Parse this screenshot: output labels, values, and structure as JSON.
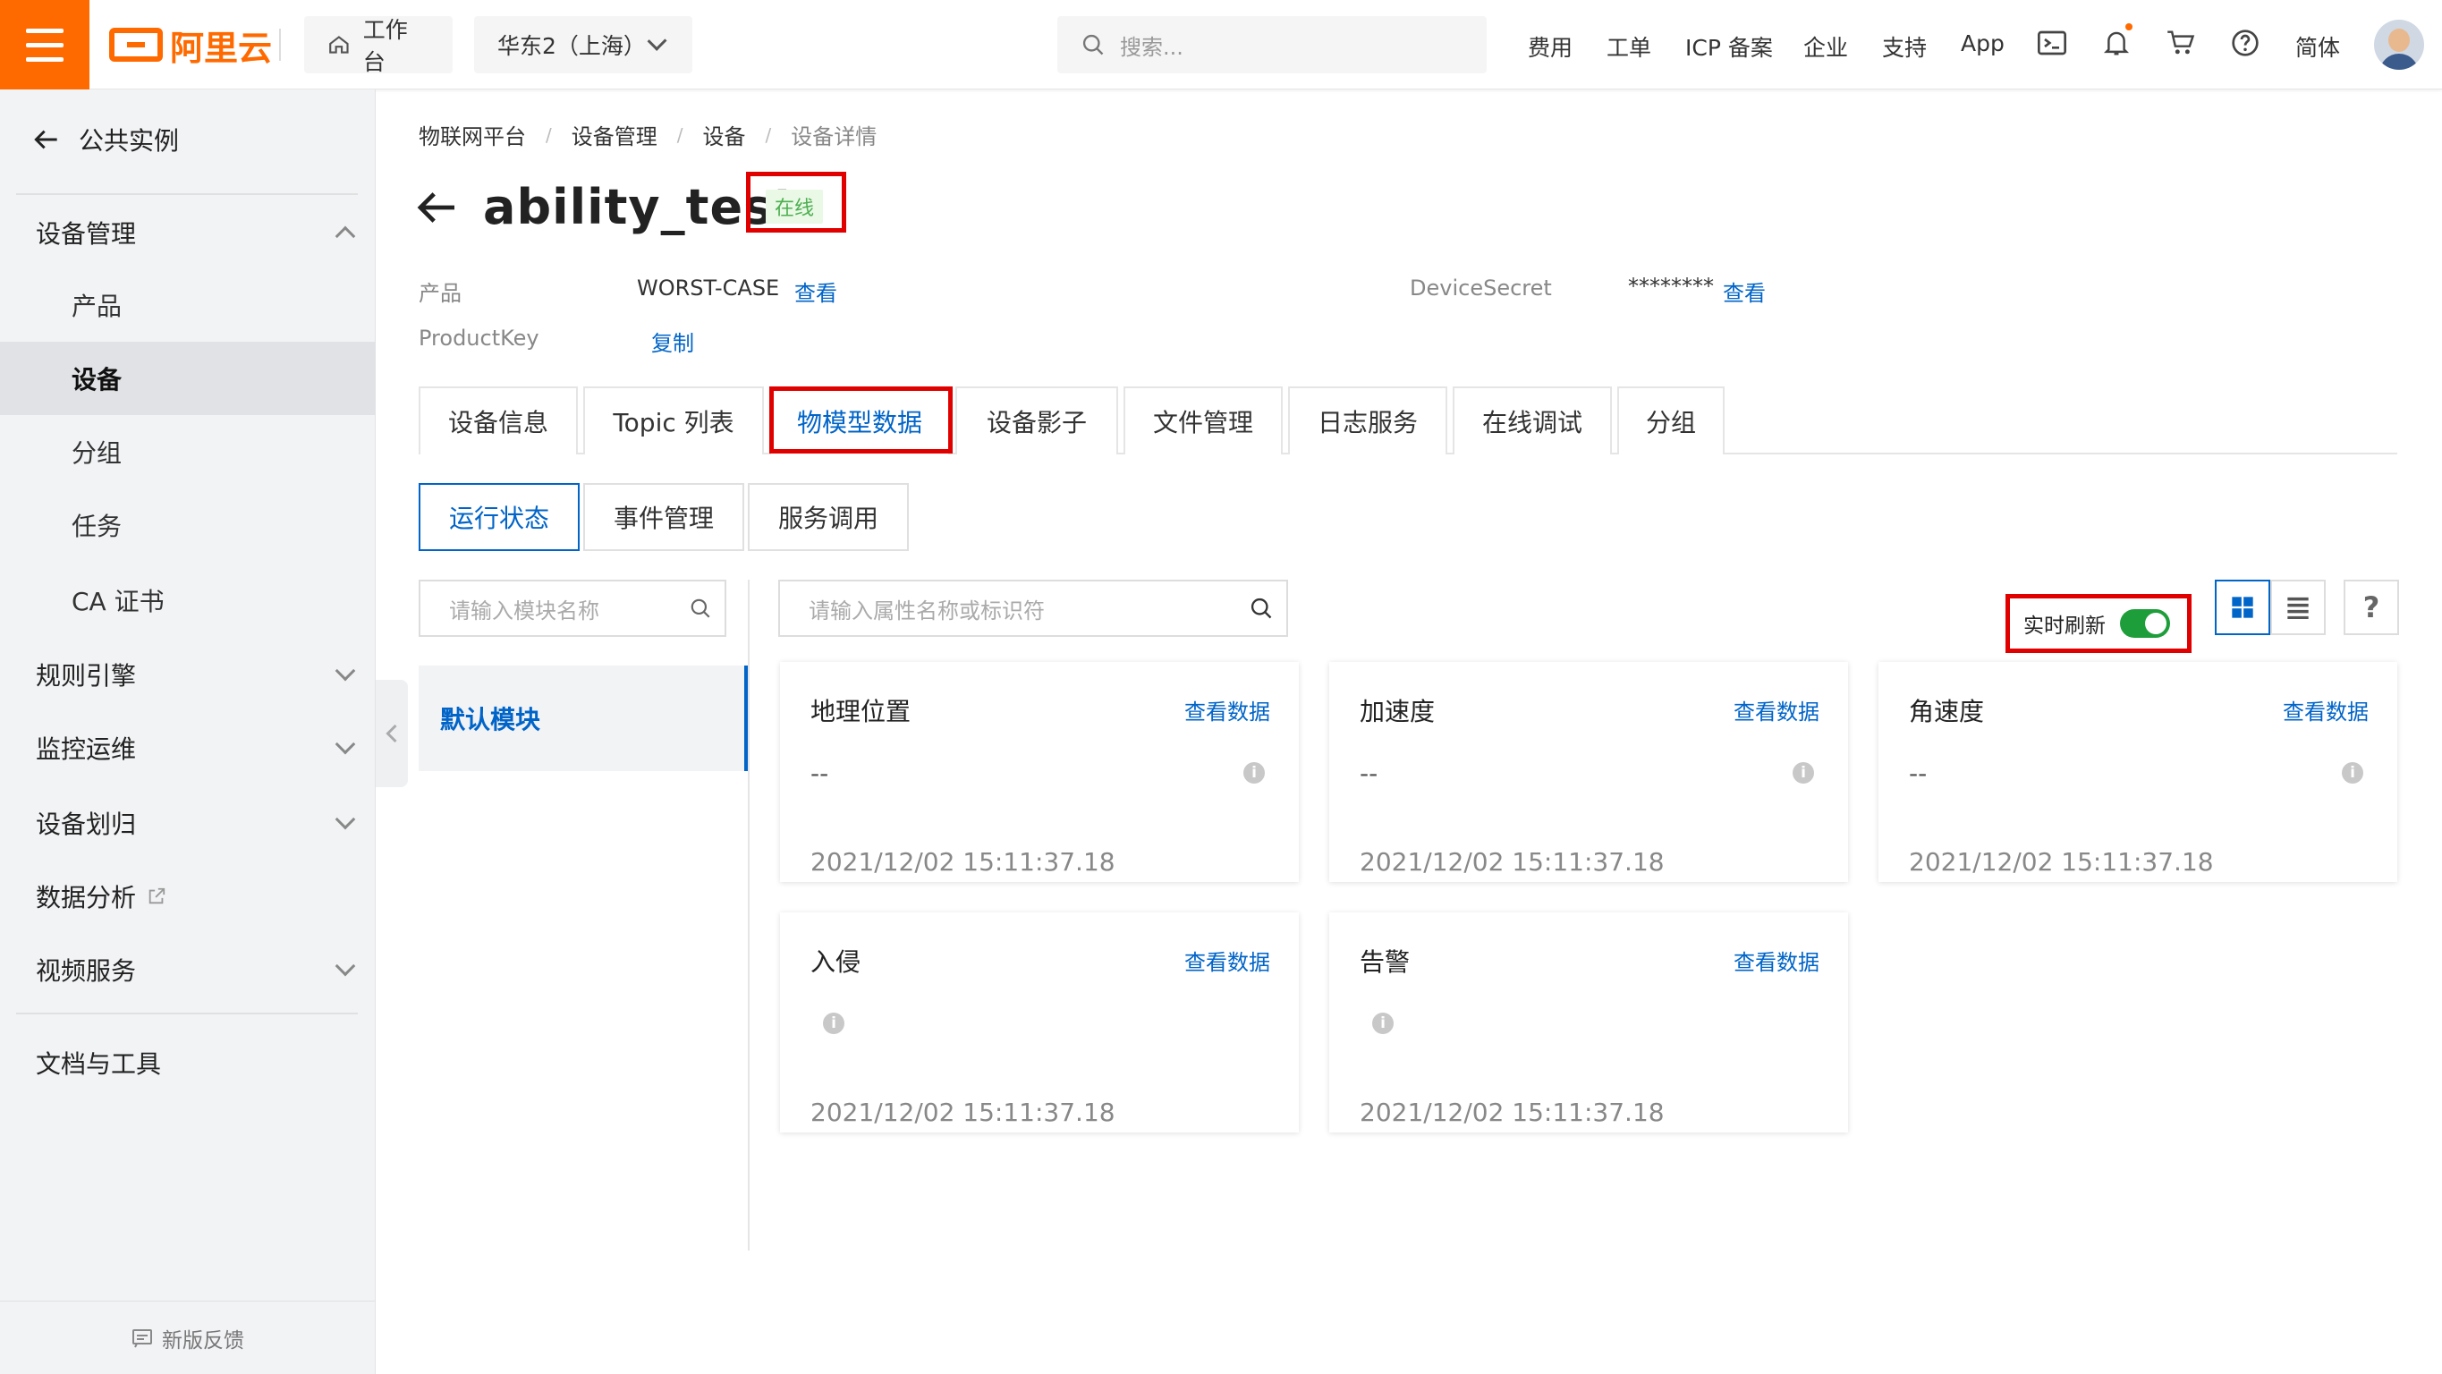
{
  "topbar": {
    "logo_text": "阿里云",
    "workbench": "工作台",
    "region": "华东2（上海）",
    "search_placeholder": "搜索...",
    "links": [
      "费用",
      "工单",
      "ICP 备案",
      "企业",
      "支持",
      "App"
    ],
    "lang": "简体",
    "accent": "#ff6a00"
  },
  "sidebar": {
    "back_label": "公共实例",
    "groups": [
      {
        "label": "设备管理",
        "expanded": true,
        "items": [
          "产品",
          "设备",
          "分组",
          "任务",
          "CA 证书"
        ],
        "active": "设备"
      },
      {
        "label": "规则引擎",
        "expanded": false
      },
      {
        "label": "监控运维",
        "expanded": false
      },
      {
        "label": "设备划归",
        "expanded": false
      },
      {
        "label": "数据分析",
        "external": true
      },
      {
        "label": "视频服务",
        "expanded": false
      }
    ],
    "docs_label": "文档与工具",
    "feedback_label": "新版反馈"
  },
  "breadcrumb": [
    "物联网平台",
    "设备管理",
    "设备",
    "设备详情"
  ],
  "device": {
    "name": "ability_test",
    "status": "在线",
    "status_color": "#4caf50",
    "product_label": "产品",
    "product_value": "WORST-CASE",
    "product_link": "查看",
    "productkey_label": "ProductKey",
    "productkey_link": "复制",
    "secret_label": "DeviceSecret",
    "secret_value": "********",
    "secret_link": "查看"
  },
  "tabs": [
    "设备信息",
    "Topic 列表",
    "物模型数据",
    "设备影子",
    "文件管理",
    "日志服务",
    "在线调试",
    "分组"
  ],
  "active_tab": "物模型数据",
  "subtabs": [
    "运行状态",
    "事件管理",
    "服务调用"
  ],
  "active_subtab": "运行状态",
  "module_search_placeholder": "请输入模块名称",
  "property_search_placeholder": "请输入属性名称或标识符",
  "default_module": "默认模块",
  "realtime_label": "实时刷新",
  "realtime_on": true,
  "cards": [
    {
      "title": "地理位置",
      "link": "查看数据",
      "value": "--",
      "time": "2021/12/02 15:11:37.18"
    },
    {
      "title": "加速度",
      "link": "查看数据",
      "value": "--",
      "time": "2021/12/02 15:11:37.18"
    },
    {
      "title": "角速度",
      "link": "查看数据",
      "value": "--",
      "time": "2021/12/02 15:11:37.18"
    },
    {
      "title": "入侵",
      "link": "查看数据",
      "value": "",
      "time": "2021/12/02 15:11:37.18"
    },
    {
      "title": "告警",
      "link": "查看数据",
      "value": "",
      "time": "2021/12/02 15:11:37.18"
    }
  ]
}
